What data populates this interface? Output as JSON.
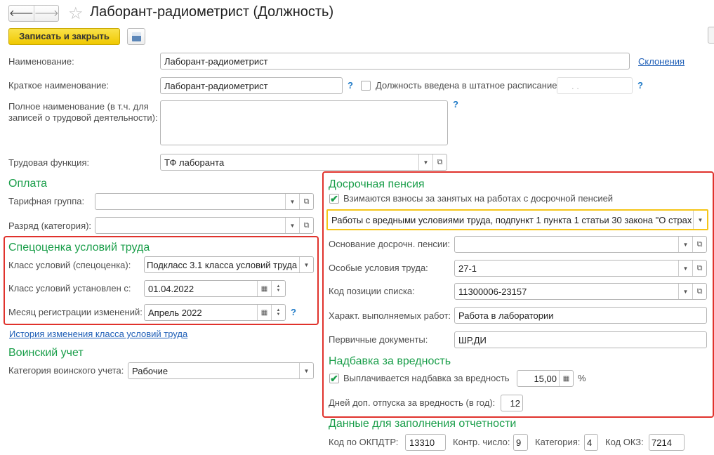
{
  "window": {
    "title": "Лаборант-радиометрист (Должность)"
  },
  "toolbar": {
    "save_close": "Записать и закрыть"
  },
  "fields": {
    "name_label": "Наименование:",
    "name_value": "Лаборант-радиометрист",
    "declensions_link": "Склонения",
    "short_label": "Краткое наименование:",
    "short_value": "Лаборант-радиометрист",
    "staff_label": "Должность введена в штатное расписание",
    "staff_date": " .  .",
    "full_label": "Полное наименование (в т.ч. для записей о трудовой деятельности):",
    "full_value": "",
    "func_label": "Трудовая функция:",
    "func_value": "ТФ лаборанта"
  },
  "payment": {
    "header": "Оплата",
    "tariff_label": "Тарифная группа:",
    "tariff_value": "",
    "grade_label": "Разряд (категория):",
    "grade_value": ""
  },
  "sout": {
    "header": "Спецоценка условий труда",
    "class_label": "Класс условий (спецоценка):",
    "class_value": "Подкласс 3.1 класса условий труда",
    "since_label": "Класс условий установлен с:",
    "since_value": "01.04.2022",
    "month_label": "Месяц регистрации изменений:",
    "month_value": "Апрель 2022",
    "history_link": "История изменения класса условий труда"
  },
  "military": {
    "header": "Воинский учет",
    "cat_label": "Категория воинского учета:",
    "cat_value": "Рабочие"
  },
  "pension": {
    "header": "Досрочная пенсия",
    "contrib_label": "Взимаются взносы за занятых на работах с досрочной пенсией",
    "contrib_checked": true,
    "type_value": "Работы с вредными условиями труда, подпункт 1 пункта 1 статьи 30 закона \"О страх",
    "basis_label": "Основание досрочн. пенсии:",
    "basis_value": "",
    "special_label": "Особые условия труда:",
    "special_value": "27-1",
    "code_label": "Код позиции списка:",
    "code_value": "11300006-23157",
    "work_label": "Характ. выполняемых работ:",
    "work_value": "Работа в лаборатории",
    "docs_label": "Первичные документы:",
    "docs_value": "ШР,ДИ"
  },
  "hazard": {
    "header": "Надбавка за вредность",
    "pay_label": "Выплачивается надбавка за вредность",
    "pay_checked": true,
    "pay_value": "15,00",
    "pct": "%",
    "days_label": "Дней доп. отпуска за вредность (в год):",
    "days_value": "12"
  },
  "report": {
    "header": "Данные для заполнения отчетности",
    "okpdtr_label": "Код по ОКПДТР:",
    "okpdtr_value": "13310",
    "ctrl_label": "Контр. число:",
    "ctrl_value": "9",
    "cat_label": "Категория:",
    "cat_value": "4",
    "okz_label": "Код ОКЗ:",
    "okz_value": "7214"
  },
  "help": "?"
}
